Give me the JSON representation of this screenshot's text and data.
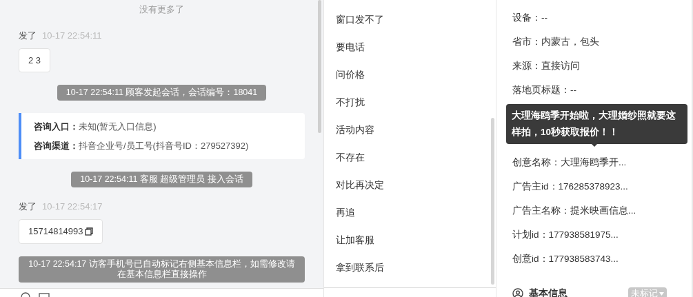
{
  "chat": {
    "no_more": "没有更多了",
    "items": [
      {
        "kind": "message",
        "sender": "发了",
        "time": "10-17 22:54:11",
        "text": "2 3",
        "copyable": false
      },
      {
        "kind": "system",
        "text": "10-17 22:54:11 顾客发起会话，会话编号：18041"
      },
      {
        "kind": "info",
        "rows": [
          {
            "label": "咨询入口：",
            "value": "未知(暂无入口信息)"
          },
          {
            "label": "咨询渠道：",
            "value": "抖音企业号/员工号(抖音号ID：279527392)"
          }
        ]
      },
      {
        "kind": "system",
        "text": "10-17 22:54:11 客服 超级管理员 接入会话"
      },
      {
        "kind": "message",
        "sender": "发了",
        "time": "10-17 22:54:17",
        "text": "15714814993",
        "copyable": true
      },
      {
        "kind": "system",
        "text": "10-17 22:54:17 访客手机号已自动标记右侧基本信息栏，如需修改请在基本信息栏直接操作"
      }
    ]
  },
  "quick_replies": [
    "窗口发不了",
    "要电话",
    "问价格",
    "不打扰",
    "活动内容",
    "不存在",
    "对比再决定",
    "再追",
    "让加客服",
    "拿到联系后"
  ],
  "details": {
    "rows": [
      "设备：--",
      "省市：内蒙古，包头",
      "来源：直接访问",
      "落地页标题：--",
      "创意名称：大理海鸥季开...",
      "广告主id：176285378923...",
      "广告主名称：提米映画信息...",
      "计划id：177938581975...",
      "创意id：177938583743..."
    ],
    "tooltip": "大理海鸥季开始啦，大理婚纱照就要这样拍，10秒获取报价！！",
    "section": {
      "title": "基本信息",
      "tag": "未标记"
    }
  }
}
